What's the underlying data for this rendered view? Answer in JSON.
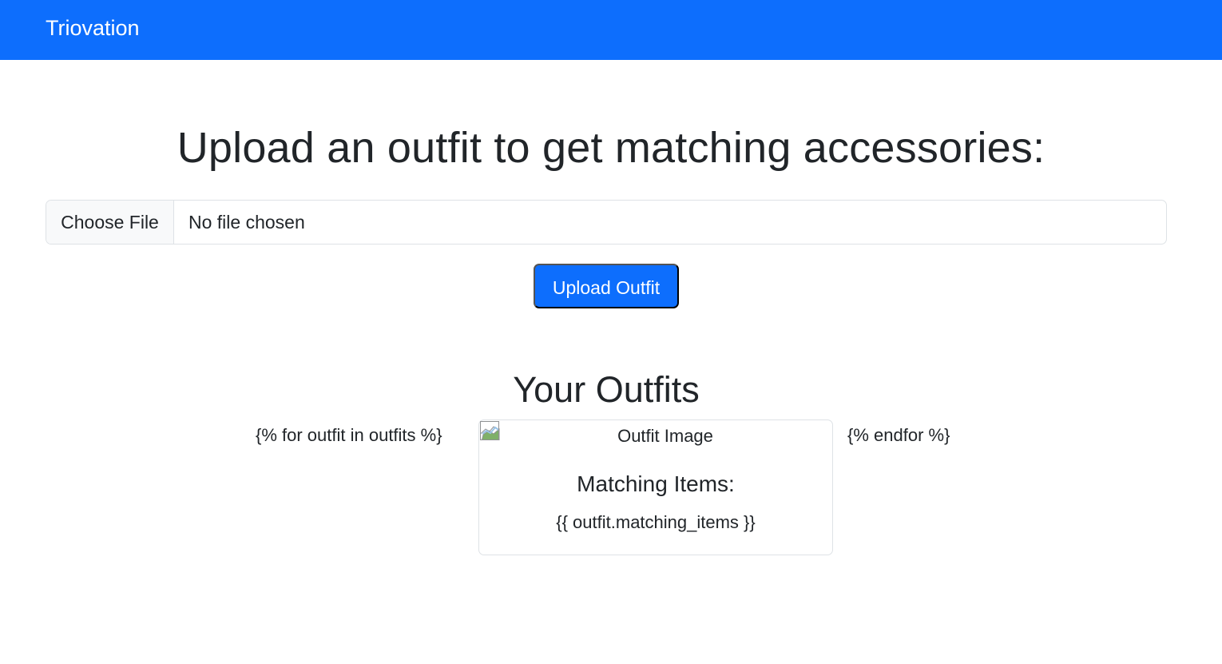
{
  "navbar": {
    "brand": "Triovation",
    "background_color": "#0d6efd"
  },
  "upload": {
    "title": "Upload an outfit to get matching accessories:",
    "file_button_label": "Choose File",
    "file_status": "No file chosen",
    "submit_label": "Upload Outfit"
  },
  "outfits": {
    "title": "Your Outfits",
    "loop_start": "{% for outfit in outfits %}",
    "loop_end": "{% endfor %}",
    "card": {
      "image_alt": "Outfit Image",
      "image_icon": "broken-image-icon",
      "title": "Matching Items:",
      "text": "{{ outfit.matching_items }}"
    }
  },
  "colors": {
    "primary": "#0d6efd",
    "text": "#212529",
    "border": "#dee2e6",
    "file_button_bg": "#f8f9fa"
  }
}
